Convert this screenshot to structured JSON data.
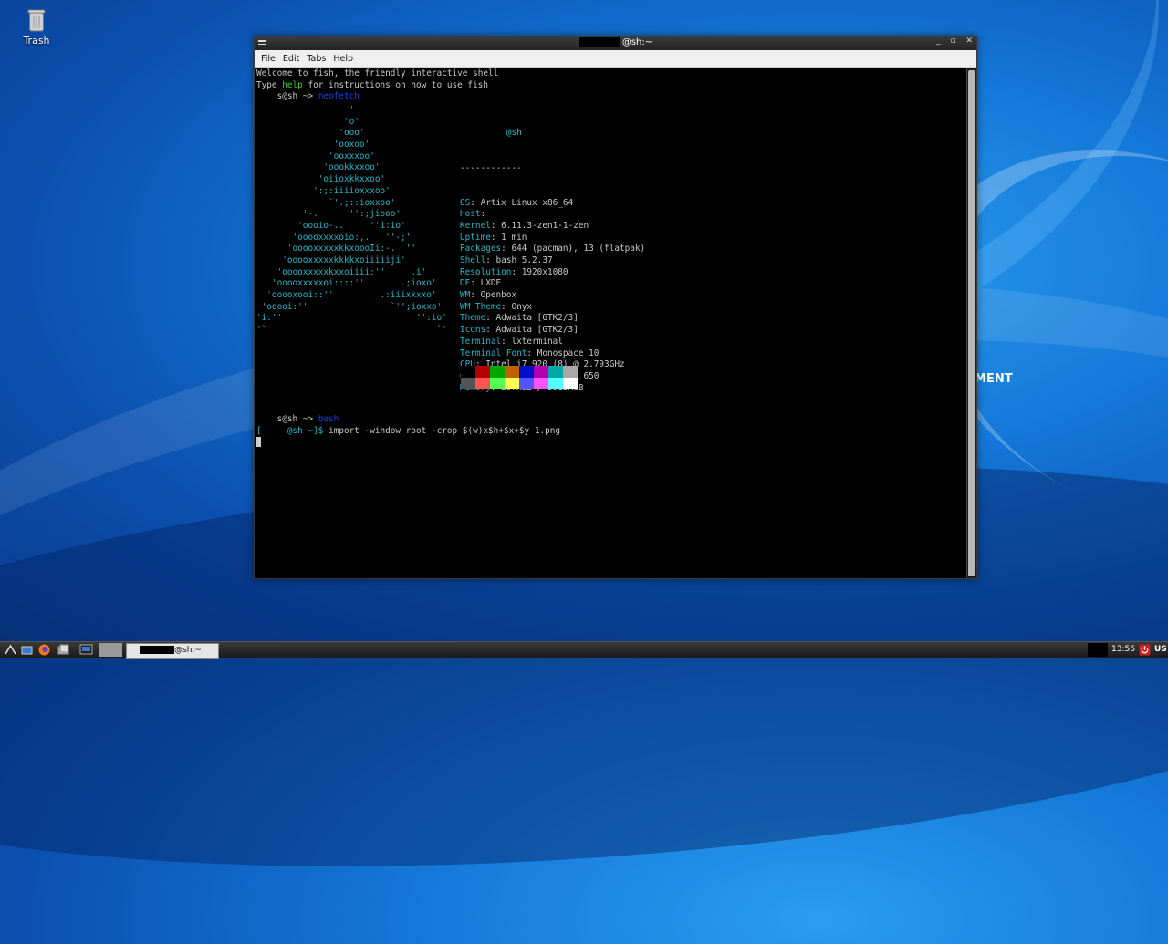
{
  "desktop": {
    "trash_label": "Trash",
    "brand_text": "MENT"
  },
  "window": {
    "title": "@sh:~",
    "controls": [
      "_",
      "▫",
      "✕"
    ]
  },
  "menu": [
    "File",
    "Edit",
    "Tabs",
    "Help"
  ],
  "terminal": {
    "welcome": "Welcome to fish, the friendly interactive shell",
    "type_pre": "Type ",
    "type_help": "help",
    "type_post": " for instructions on how to use fish",
    "prompt1_user": "s@sh",
    "prompt1_arrow": " ~> ",
    "prompt1_cmd": "neofetch",
    "logo": [
      "                  '",
      "                 'o'",
      "                'ooo'",
      "               'ooxoo'",
      "              'ooxxxoo'",
      "             'oookkxxoo'",
      "            'oiioxkkxxoo'",
      "           ':;:iiiioxxxoo'",
      "              `'.;::ioxxoo'",
      "         '-.      '':;jiooo'",
      "        'oooio-..     ''i:io'",
      "       'ooooxxxxoio:,.   ''-;'",
      "      'ooooxxxxxkkxoooIi:-.  ''",
      "     'ooooxxxxxkkkkxoiiiiiji'",
      "    'ooooxxxxxkxxoiiii:''     .i'",
      "   'ooooxxxxxoi::::''       .;ioxo'",
      "  'ooooxooi::''         .:iiixkxxo'",
      " 'ooooi:''                `'';ioxxo'",
      "'i:''                          '':io'",
      "'`                                 `'"
    ],
    "host_header": "@sh",
    "separator": "------------",
    "info": [
      {
        "k": "OS",
        "v": "Artix Linux x86_64"
      },
      {
        "k": "Host",
        "v": ""
      },
      {
        "k": "Kernel",
        "v": "6.11.3-zen1-1-zen"
      },
      {
        "k": "Uptime",
        "v": "1 min"
      },
      {
        "k": "Packages",
        "v": "644 (pacman), 13 (flatpak)"
      },
      {
        "k": "Shell",
        "v": "bash 5.2.37"
      },
      {
        "k": "Resolution",
        "v": "1920x1080"
      },
      {
        "k": "DE",
        "v": "LXDE"
      },
      {
        "k": "WM",
        "v": "Openbox"
      },
      {
        "k": "WM Theme",
        "v": "Onyx"
      },
      {
        "k": "Theme",
        "v": "Adwaita [GTK2/3]"
      },
      {
        "k": "Icons",
        "v": "Adwaita [GTK2/3]"
      },
      {
        "k": "Terminal",
        "v": "lxterminal"
      },
      {
        "k": "Terminal Font",
        "v": "Monospace 10"
      },
      {
        "k": "CPU",
        "v": "Intel i7 920 (8) @ 2.793GHz"
      },
      {
        "k": "GPU",
        "v": "NVIDIA GeForce GTX 650"
      },
      {
        "k": "Memory",
        "v": "297MiB / 3913MiB"
      }
    ],
    "palette_top": [
      "#000000",
      "#b40000",
      "#00a800",
      "#c06000",
      "#0010c8",
      "#b000b0",
      "#00a8a8",
      "#a8a8a8"
    ],
    "palette_bottom": [
      "#545454",
      "#ff5454",
      "#54ff54",
      "#ffff54",
      "#5454ff",
      "#ff54ff",
      "#54ffff",
      "#ffffff"
    ],
    "prompt2_user": "s@sh",
    "prompt2_arrow": " ~> ",
    "prompt2_cmd": "bash",
    "bash_open": "[",
    "bash_user": "@sh",
    "bash_dir": " ~]$ ",
    "bash_cmd": "import -window root -crop $(w)x$h+$x+$y 1.png"
  },
  "taskbar": {
    "task_title": "@sh:~",
    "clock": "13:56",
    "keyboard": "US"
  }
}
